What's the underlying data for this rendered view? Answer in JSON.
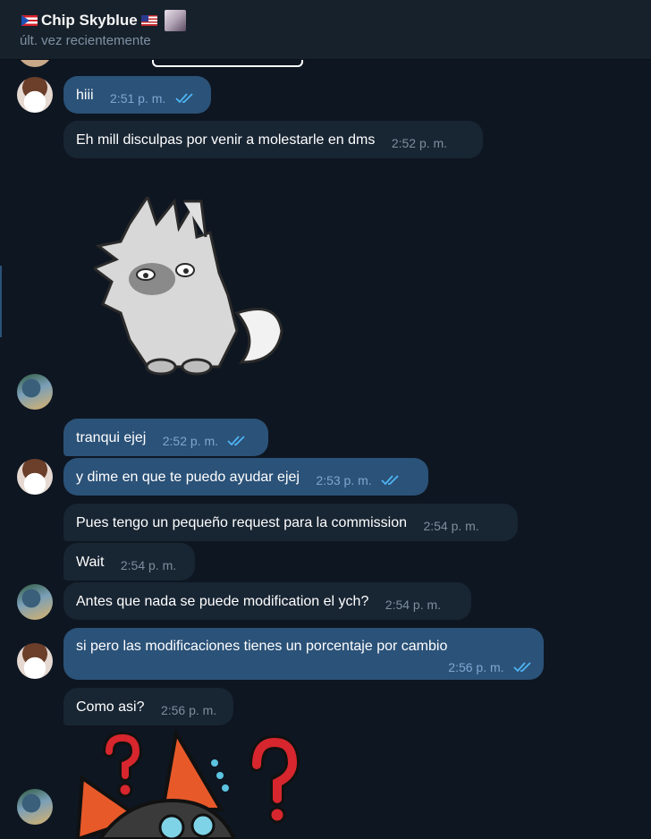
{
  "header": {
    "name": "Chip Skyblue",
    "status": "últ. vez recientemente"
  },
  "messages": [
    {
      "text": "hiii",
      "time": "2:51 p. m."
    },
    {
      "text": "Eh mill disculpas por venir a molestarle en dms",
      "time": "2:52 p. m."
    },
    {
      "text": "tranqui ejej",
      "time": "2:52 p. m."
    },
    {
      "text": "y dime en que te puedo ayudar ejej",
      "time": "2:53 p. m."
    },
    {
      "text": "Pues tengo un pequeño request para la commission",
      "time": "2:54 p. m."
    },
    {
      "text": "Wait",
      "time": "2:54 p. m."
    },
    {
      "text": "Antes que nada se puede modification el ych?",
      "time": "2:54 p. m."
    },
    {
      "text": "si pero las modificaciones tienes un porcentaje por cambio",
      "time": "2:56 p. m."
    },
    {
      "text": "Como asi?",
      "time": "2:56 p. m."
    }
  ],
  "colors": {
    "background": "#0e1621",
    "header": "#17212b",
    "outgoing_bubble": "#2b5278",
    "incoming_bubble": "#182533",
    "read_tick": "#4fb5f5"
  },
  "icons": {
    "read": "double-check-icon",
    "sticker_1": "gray-wolf-sticker",
    "sticker_2": "question-marks-fox-sticker"
  }
}
